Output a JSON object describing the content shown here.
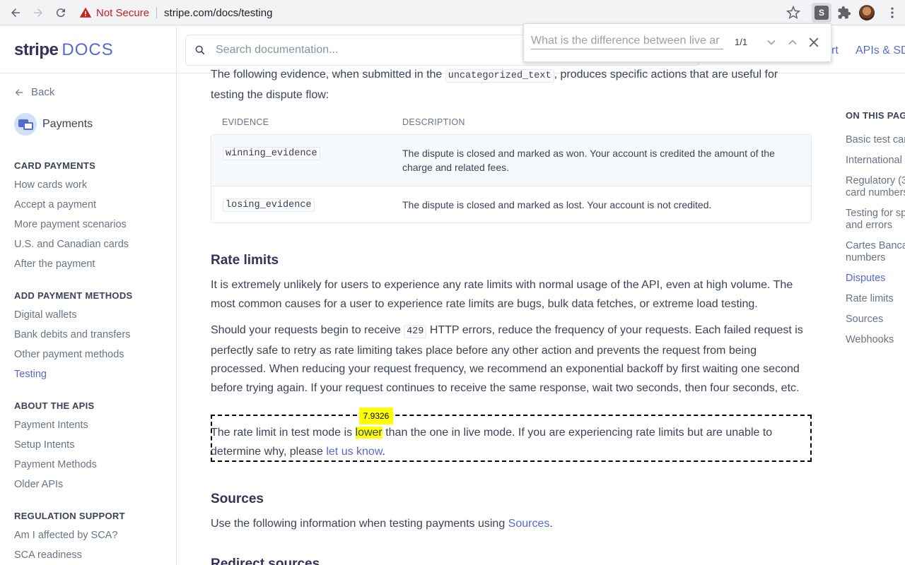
{
  "browser": {
    "security_label": "Not Secure",
    "url": "stripe.com/docs/testing",
    "extension_label": "S"
  },
  "findbar": {
    "query": "What is the difference between live ar",
    "count": "1/1"
  },
  "header": {
    "logo_stripe": "stripe",
    "logo_docs": "DOCS",
    "search_placeholder": "Search documentation...",
    "link_support": "rt",
    "link_apis": "APIs & SD"
  },
  "sidebar": {
    "back_label": "Back",
    "product_label": "Payments",
    "sections": [
      {
        "title": "CARD PAYMENTS",
        "items": [
          "How cards work",
          "Accept a payment",
          "More payment scenarios",
          "U.S. and Canadian cards",
          "After the payment"
        ]
      },
      {
        "title": "ADD PAYMENT METHODS",
        "items": [
          "Digital wallets",
          "Bank debits and transfers",
          "Other payment methods",
          "Testing"
        ]
      },
      {
        "title": "ABOUT THE APIS",
        "items": [
          "Payment Intents",
          "Setup Intents",
          "Payment Methods",
          "Older APIs"
        ]
      },
      {
        "title": "REGULATION SUPPORT",
        "items": [
          "Am I affected by SCA?",
          "SCA readiness"
        ]
      }
    ],
    "active_item": "Testing"
  },
  "content": {
    "intro_a": "The following evidence, when submitted in the ",
    "intro_code": "uncategorized_text",
    "intro_b": ", produces specific actions that are useful for",
    "intro_c": "testing the dispute flow:",
    "table": {
      "headers": [
        "EVIDENCE",
        "DESCRIPTION"
      ],
      "rows": [
        {
          "code": "winning_evidence",
          "desc": "The dispute is closed and marked as won. Your account is credited the amount of the charge and related fees."
        },
        {
          "code": "losing_evidence",
          "desc": "The dispute is closed and marked as lost. Your account is not credited."
        }
      ]
    },
    "rate_limits_heading": "Rate limits",
    "rate_p1": "It is extremely unlikely for users to experience any rate limits with normal usage of the API, even at high volume. The most common causes for a user to experience rate limits are bugs, bulk data fetches, or extreme load testing.",
    "rate_p2_a": "Should your requests begin to receive ",
    "rate_p2_code": "429",
    "rate_p2_b": " HTTP errors, reduce the frequency of your requests. Each failed request is perfectly safe to retry as rate limiting takes place before any other action and prevents the request from being processed. When reducing your request frequency, we recommend an exponential backoff by first waiting one second before trying again. If your request continues to receive the same response, wait two seconds, then four seconds, etc.",
    "rate_p3_a": "The rate limit in test mode is ",
    "rate_p3_hl": "lower",
    "rate_p3_b": " than the one in live mode. If you are experiencing rate limits but are unable to determine why, please ",
    "rate_p3_link": "let us know",
    "rate_p3_c": ".",
    "highlight_score": "7.9326",
    "sources_heading": "Sources",
    "sources_p_a": "Use the following information when testing payments using ",
    "sources_p_link": "Sources",
    "sources_p_b": ".",
    "redirect_heading": "Redirect sources"
  },
  "toc": {
    "title": "ON THIS PAG",
    "items": [
      {
        "lines": [
          "Basic test car"
        ]
      },
      {
        "lines": [
          "International"
        ]
      },
      {
        "lines": [
          "Regulatory (3",
          "card numbers"
        ]
      },
      {
        "lines": [
          "Testing for sp",
          "and errors"
        ]
      },
      {
        "lines": [
          "Cartes Banca",
          "numbers"
        ]
      },
      {
        "lines": [
          "Disputes"
        ]
      },
      {
        "lines": [
          "Rate limits"
        ]
      },
      {
        "lines": [
          "Sources"
        ]
      },
      {
        "lines": [
          "Webhooks"
        ]
      }
    ],
    "active_item": "Disputes"
  }
}
